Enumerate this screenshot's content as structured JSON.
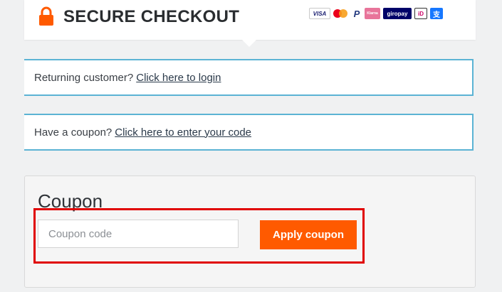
{
  "header": {
    "title": "SECURE CHECKOUT",
    "lock_color": "#ff5a00",
    "payment_methods": [
      {
        "name": "visa-icon",
        "label": "VISA"
      },
      {
        "name": "mastercard-icon",
        "label": ""
      },
      {
        "name": "paypal-icon",
        "label": "P"
      },
      {
        "name": "klarna-icon",
        "label": "Klarna"
      },
      {
        "name": "giropay-icon",
        "label": "giropay"
      },
      {
        "name": "ideal-icon",
        "label": "iD"
      },
      {
        "name": "alipay-icon",
        "label": "支"
      }
    ]
  },
  "notices": {
    "login_prefix": "Returning customer?",
    "login_link": "Click here to login",
    "coupon_prefix": "Have a coupon?",
    "coupon_link": "Click here to enter your code"
  },
  "coupon": {
    "title": "Coupon",
    "input_placeholder": "Coupon code",
    "input_value": "",
    "apply_label": "Apply coupon"
  },
  "colors": {
    "accent": "#ff5a00",
    "notice_border": "#5bb3d4",
    "highlight": "#e00000"
  }
}
